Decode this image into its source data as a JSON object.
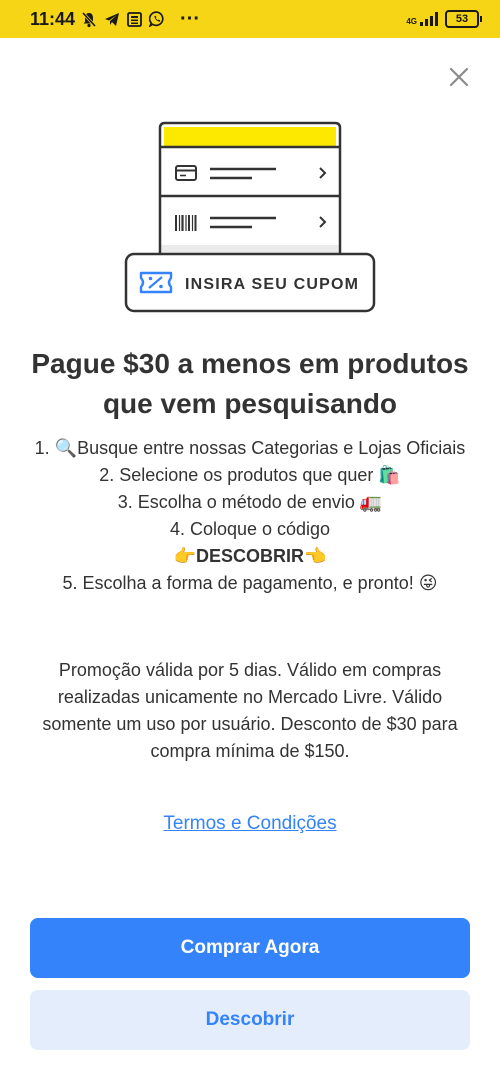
{
  "status_bar": {
    "time": "11:44",
    "left_icons": [
      "bell-off-icon",
      "telegram-icon",
      "news-icon",
      "whatsapp-icon",
      "more-dots-icon"
    ],
    "more_dots": "···",
    "network_label": "4G",
    "battery": "53"
  },
  "illustration": {
    "coupon_label": "INSIRA SEU CUPOM"
  },
  "title": "Pague $30 a menos em produtos que vem pesquisando",
  "steps": [
    "1. 🔍Busque entre nossas Categorias e Lojas Oficiais",
    "2. Selecione os produtos que quer 🛍️",
    "3. Escolha o método de envio 🚛",
    "4. Coloque o código",
    "👉DESCOBRIR👈",
    "5. Escolha a forma de pagamento, e pronto! 😜"
  ],
  "promo_text": "Promoção válida por 5 dias. Válido em compras realizadas unicamente no Mercado Livre. Válido somente um uso por usuário. Desconto de $30 para compra mínima de $150.",
  "terms_link": "Termos e Condições ",
  "buttons": {
    "primary": "Comprar Agora",
    "secondary": "Descobrir"
  },
  "colors": {
    "status_bar": "#f6d516",
    "accent_blue": "#3483fa",
    "secondary_button_bg": "#e3edfb",
    "text": "#333333"
  }
}
